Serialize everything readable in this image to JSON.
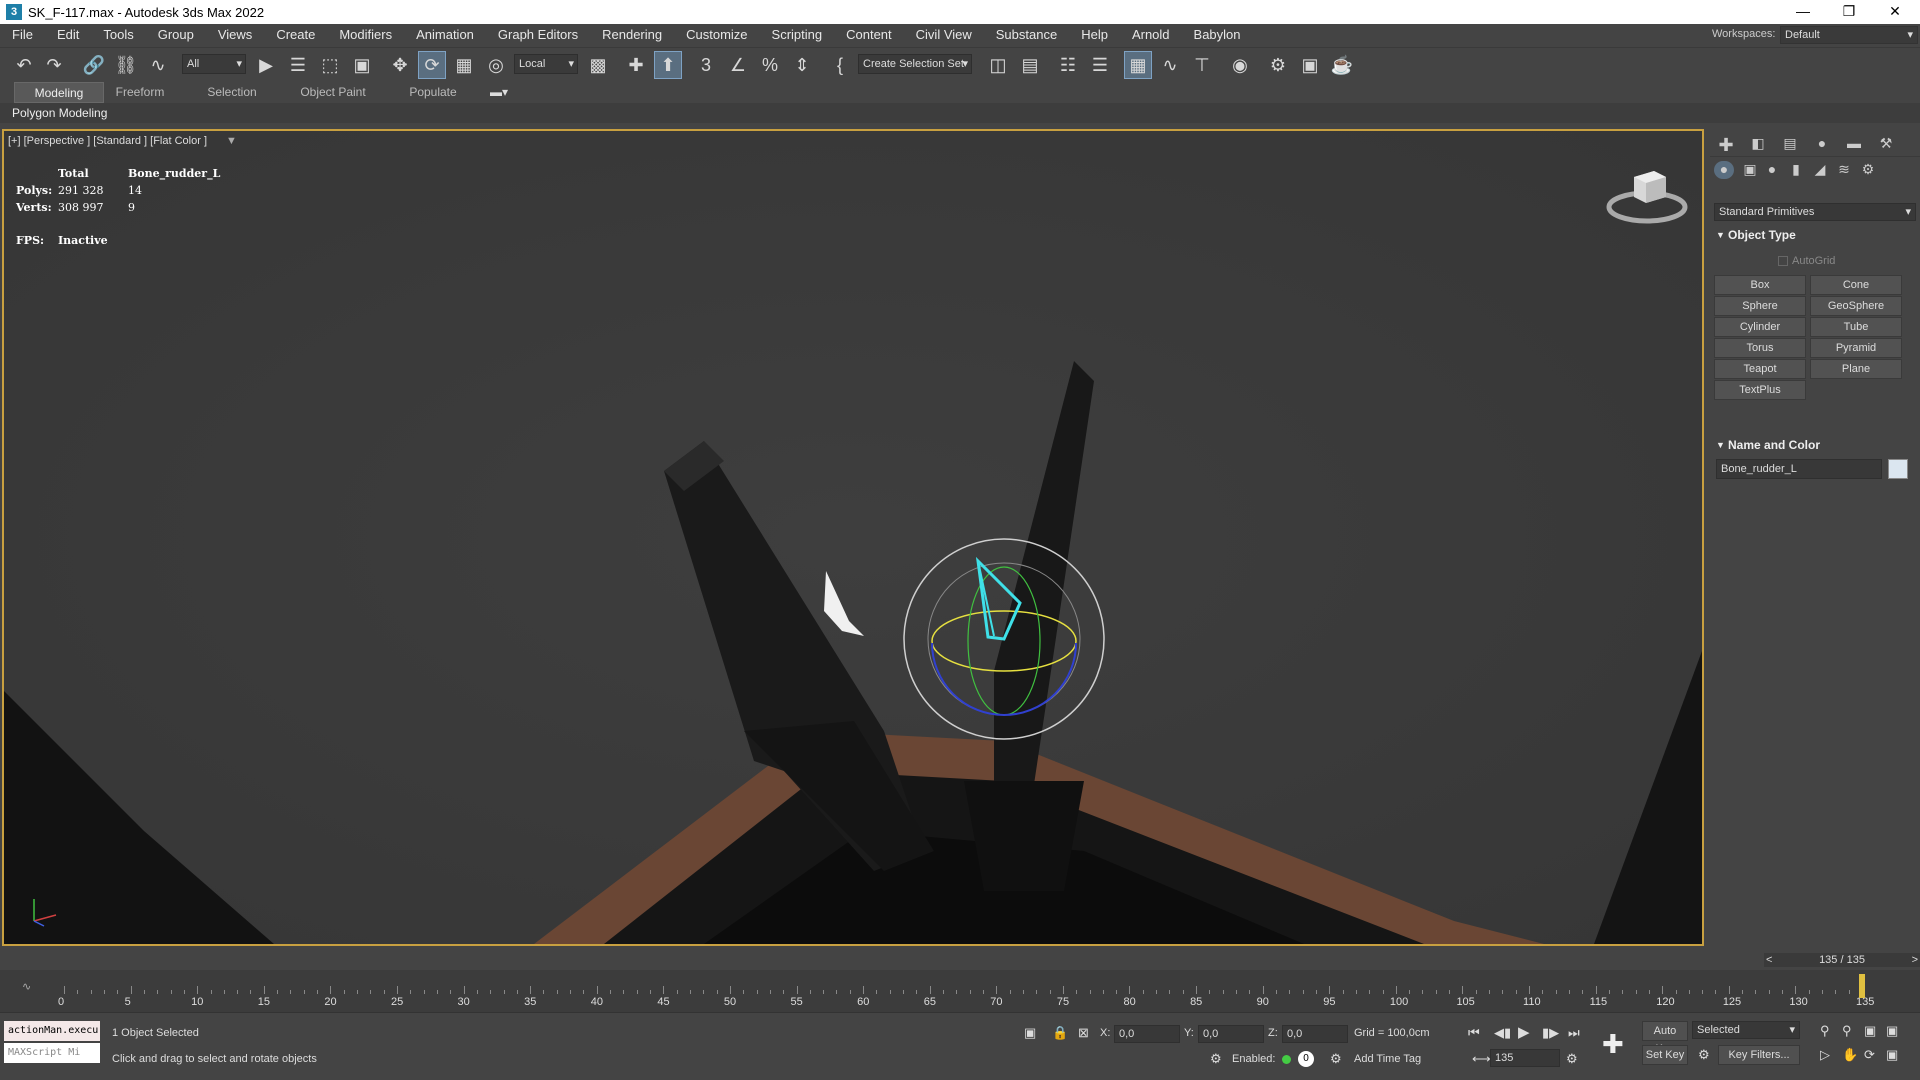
{
  "window": {
    "title": "SK_F-117.max - Autodesk 3ds Max 2022",
    "icon": "3ds-max-icon"
  },
  "menu": [
    "File",
    "Edit",
    "Tools",
    "Group",
    "Views",
    "Create",
    "Modifiers",
    "Animation",
    "Graph Editors",
    "Rendering",
    "Customize",
    "Scripting",
    "Content",
    "Civil View",
    "Substance",
    "Help",
    "Arnold",
    "Babylon"
  ],
  "workspace": {
    "label": "Workspaces:",
    "value": "Default"
  },
  "toolbar": {
    "filter": "All",
    "ref_coord": "Local",
    "selection_set": "Create Selection Set"
  },
  "ribbon": {
    "tabs": [
      "Modeling",
      "Freeform",
      "Selection",
      "Object Paint",
      "Populate"
    ],
    "active": "Modeling",
    "sub": "Polygon Modeling"
  },
  "viewport": {
    "label": "[+] [Perspective ] [Standard ] [Flat Color ]",
    "stats": {
      "total_hdr": "Total",
      "obj_hdr": "Bone_rudder_L",
      "polys_label": "Polys:",
      "polys_total": "291 328",
      "polys_obj": "14",
      "verts_label": "Verts:",
      "verts_total": "308 997",
      "verts_obj": "9",
      "fps_label": "FPS:",
      "fps_value": "Inactive"
    }
  },
  "command_panel": {
    "category": "Standard Primitives",
    "object_type_title": "Object Type",
    "autogrid": "AutoGrid",
    "primitives": [
      "Box",
      "Cone",
      "Sphere",
      "GeoSphere",
      "Cylinder",
      "Tube",
      "Torus",
      "Pyramid",
      "Teapot",
      "Plane",
      "TextPlus"
    ],
    "name_color_title": "Name and Color",
    "object_name": "Bone_rudder_L",
    "object_color": "#dbe6f0"
  },
  "timeline": {
    "current": "135 / 135",
    "ticks": [
      0,
      5,
      10,
      15,
      20,
      25,
      30,
      35,
      40,
      45,
      50,
      55,
      60,
      65,
      70,
      75,
      80,
      85,
      90,
      95,
      100,
      105,
      110,
      115,
      120,
      125,
      130,
      135
    ],
    "max": 135
  },
  "status": {
    "maxscript1": "actionMan.execu",
    "maxscript2": "MAXScript Mi",
    "selected": "1 Object Selected",
    "prompt": "Click and drag to select and rotate objects",
    "x_label": "X:",
    "x": "0,0",
    "y_label": "Y:",
    "y": "0,0",
    "z_label": "Z:",
    "z": "0,0",
    "grid": "Grid = 100,0cm",
    "enabled": "Enabled:",
    "add_time_tag": "Add Time Tag",
    "auto_key": "Auto Key",
    "set_key": "Set Key",
    "key_mode": "Selected",
    "key_filters": "Key Filters...",
    "frame": "135"
  },
  "colors": {
    "accent": "#c8a040",
    "gizmo_cyan": "#3fe0e8",
    "active_btn": "#5a6e80"
  }
}
